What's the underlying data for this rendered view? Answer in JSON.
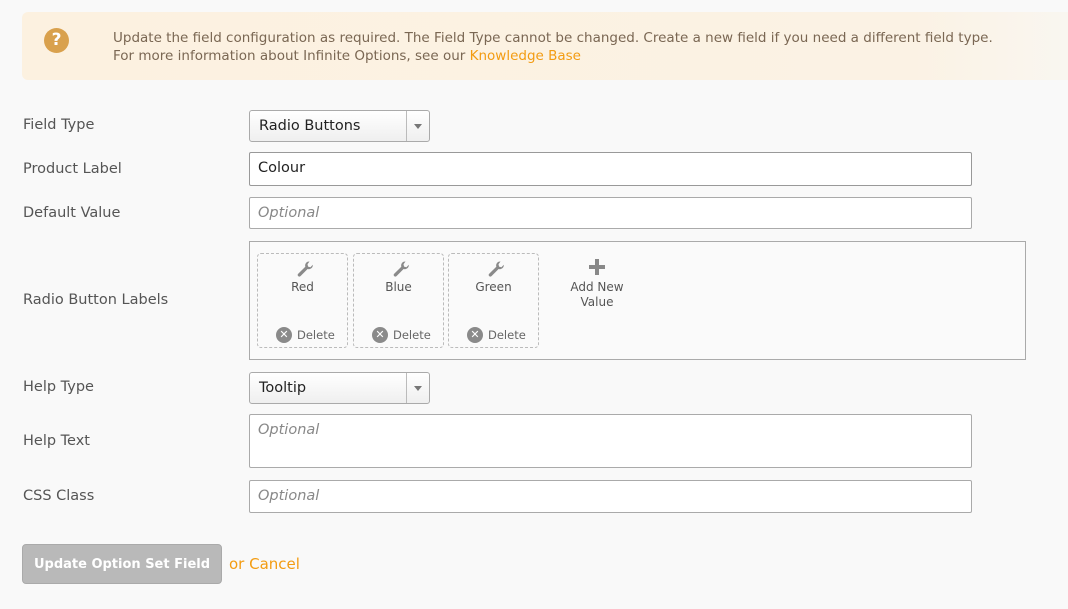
{
  "notice": {
    "icon": "question-icon",
    "line1": "Update the field configuration as required. The Field Type cannot be changed. Create a new field if you need a different field type.",
    "line2_prefix": "For more information about Infinite Options, see our ",
    "link_text": "Knowledge Base"
  },
  "form": {
    "field_type": {
      "label": "Field Type",
      "value": "Radio Buttons"
    },
    "product_label": {
      "label": "Product Label",
      "value": "Colour"
    },
    "default_value": {
      "label": "Default Value",
      "placeholder": "Optional"
    },
    "radio_labels": {
      "label": "Radio Button Labels",
      "values": [
        {
          "name": "Red",
          "delete_label": "Delete"
        },
        {
          "name": "Blue",
          "delete_label": "Delete"
        },
        {
          "name": "Green",
          "delete_label": "Delete"
        }
      ],
      "add_new_line1": "Add New",
      "add_new_line2": "Value"
    },
    "help_type": {
      "label": "Help Type",
      "value": "Tooltip"
    },
    "help_text": {
      "label": "Help Text",
      "placeholder": "Optional"
    },
    "css_class": {
      "label": "CSS Class",
      "placeholder": "Optional"
    }
  },
  "actions": {
    "submit_label": "Update Option Set Field",
    "or_text": "or ",
    "cancel_label": "Cancel"
  },
  "colors": {
    "accent": "#f39c12",
    "notice_bg": "#fcf1e0",
    "notice_icon": "#d9a14d",
    "button_disabled": "#b9b9b9"
  }
}
